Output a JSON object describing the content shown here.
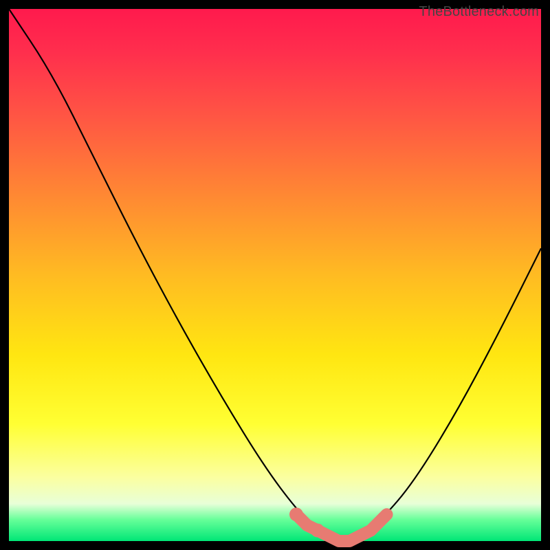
{
  "watermark": "TheBottleneck.com",
  "chart_data": {
    "type": "line",
    "title": "",
    "xlabel": "",
    "ylabel": "",
    "xlim": [
      0,
      100
    ],
    "ylim": [
      0,
      100
    ],
    "description": "Bottleneck curve over rainbow gradient background; minimum near x≈62 with flat salmon-highlighted region",
    "series": [
      {
        "name": "bottleneck-curve",
        "x": [
          0,
          8,
          16,
          24,
          32,
          40,
          48,
          54,
          58,
          62,
          66,
          70,
          76,
          84,
          92,
          100
        ],
        "y": [
          100,
          88,
          72,
          56,
          41,
          27,
          14,
          6,
          2,
          0,
          1,
          4,
          11,
          24,
          39,
          55
        ]
      }
    ],
    "highlight": {
      "name": "flat-minimum-region",
      "color": "#e77b72",
      "x": [
        54,
        56,
        58,
        60,
        62,
        64,
        66,
        68,
        70,
        71
      ],
      "y": [
        5,
        3,
        2,
        1,
        0,
        0,
        1,
        2,
        4,
        5
      ]
    }
  }
}
